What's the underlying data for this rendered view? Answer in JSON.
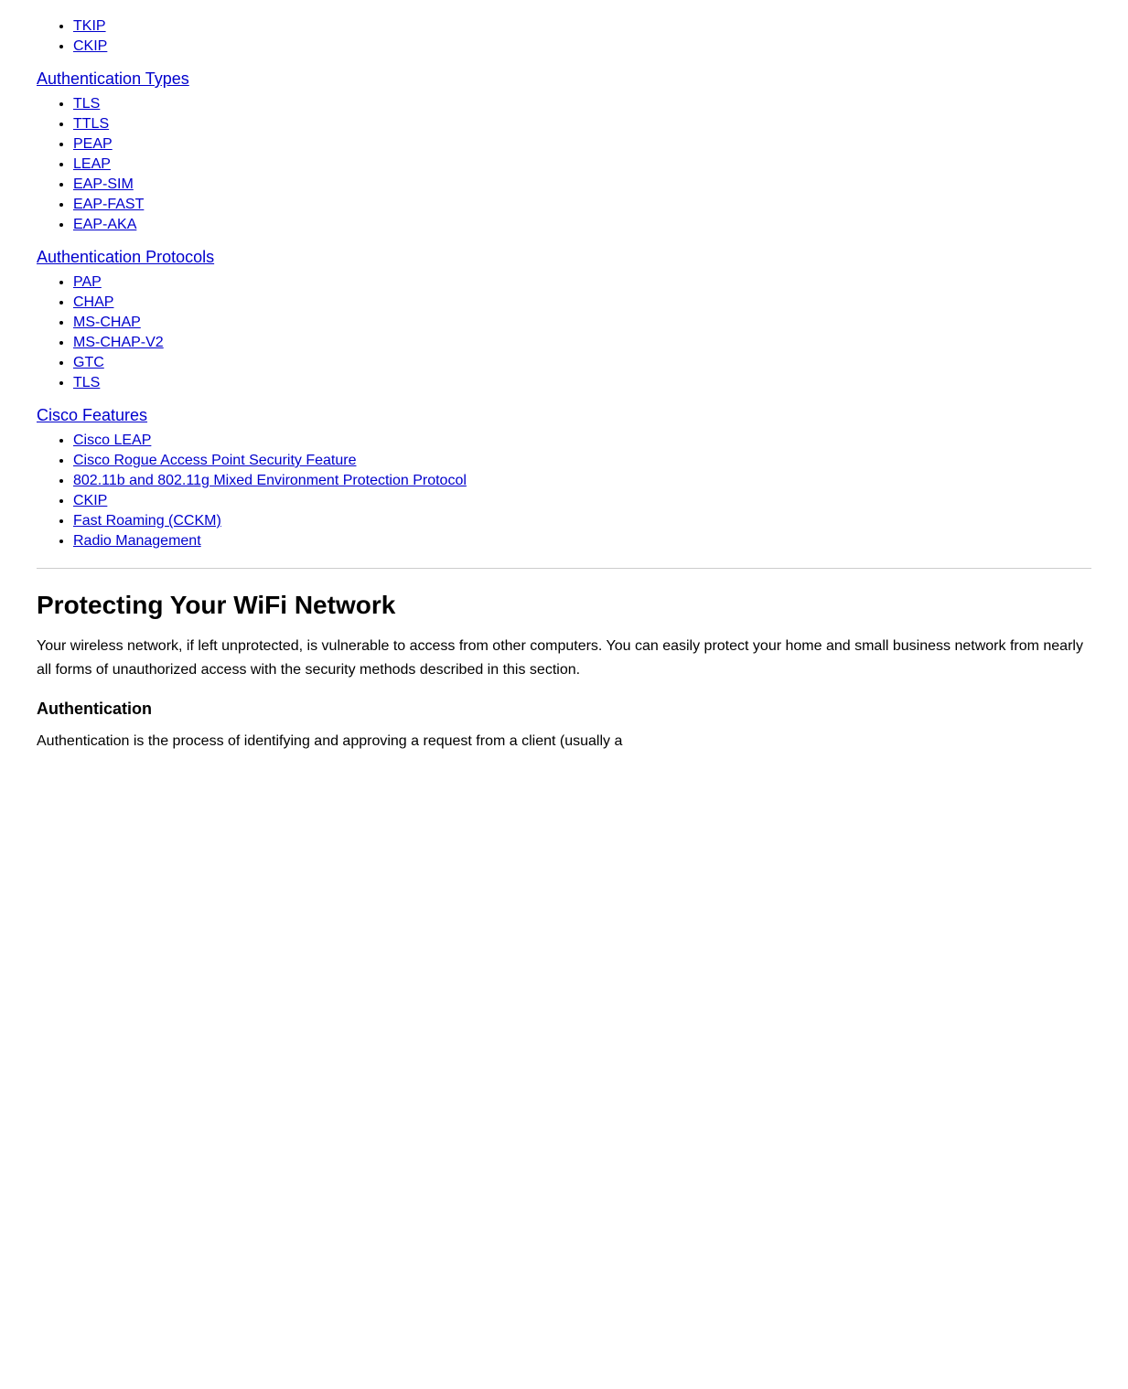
{
  "topList": {
    "items": [
      {
        "label": "TKIP",
        "href": "#"
      },
      {
        "label": "CKIP",
        "href": "#"
      }
    ]
  },
  "authTypes": {
    "heading": "Authentication Types",
    "href": "#",
    "items": [
      {
        "label": "TLS",
        "href": "#"
      },
      {
        "label": "TTLS",
        "href": "#"
      },
      {
        "label": "PEAP",
        "href": "#"
      },
      {
        "label": "LEAP",
        "href": "#"
      },
      {
        "label": "EAP-SIM",
        "href": "#"
      },
      {
        "label": "EAP-FAST",
        "href": "#"
      },
      {
        "label": "EAP-AKA",
        "href": "#"
      }
    ]
  },
  "authProtocols": {
    "heading": "Authentication Protocols",
    "href": "#",
    "items": [
      {
        "label": "PAP",
        "href": "#"
      },
      {
        "label": "CHAP",
        "href": "#"
      },
      {
        "label": "MS-CHAP",
        "href": "#"
      },
      {
        "label": "MS-CHAP-V2",
        "href": "#"
      },
      {
        "label": "GTC",
        "href": "#"
      },
      {
        "label": "TLS",
        "href": "#"
      }
    ]
  },
  "ciscoFeatures": {
    "heading": "Cisco Features",
    "href": "#",
    "items": [
      {
        "label": "Cisco LEAP",
        "href": "#"
      },
      {
        "label": "Cisco Rogue Access Point Security Feature",
        "href": "#"
      },
      {
        "label": "802.11b and 802.11g Mixed Environment Protection Protocol",
        "href": "#"
      },
      {
        "label": "CKIP",
        "href": "#"
      },
      {
        "label": "Fast Roaming (CCKM)",
        "href": "#"
      },
      {
        "label": "Radio Management",
        "href": "#"
      }
    ]
  },
  "mainSection": {
    "heading": "Protecting Your WiFi Network",
    "bodyText": "Your wireless network, if left unprotected, is vulnerable to access from other computers. You can easily protect your home and small business network from nearly all forms of unauthorized access with the security methods described in this section.",
    "subHeading": "Authentication",
    "subBodyText": "Authentication is the process of identifying and approving a request from a client (usually a"
  }
}
